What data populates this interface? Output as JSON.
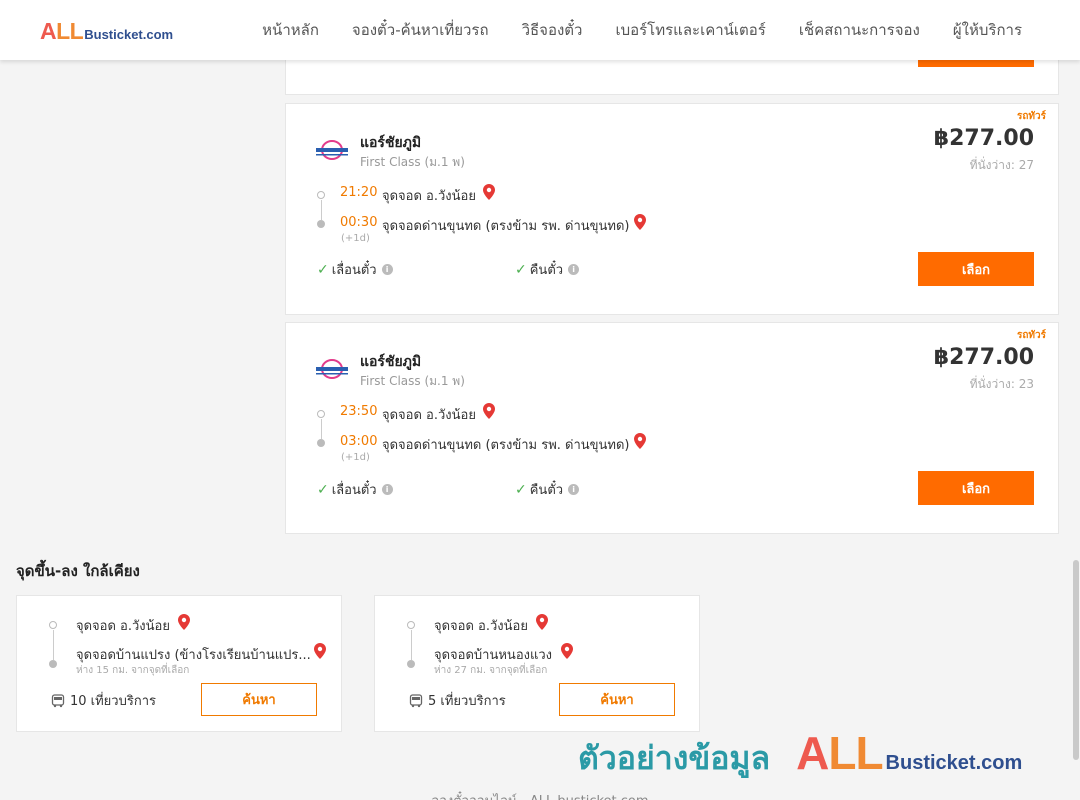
{
  "header": {
    "logo_all": "ALL",
    "logo_text": "Busticket.com",
    "nav": [
      "หน้าหลัก",
      "จองตั๋ว-ค้นหาเที่ยวรถ",
      "วิธีจองตั๋ว",
      "เบอร์โทรและเคาน์เตอร์",
      "เช็คสถานะการจอง",
      "ผู้ให้บริการ"
    ]
  },
  "trips": [
    {
      "tag": "รถทัวร์",
      "operator": "แอร์ชัยภูมิ",
      "class": "First Class (ม.1 พ)",
      "price": "฿277.00",
      "seats_label": "ที่นั่งว่าง: 27",
      "depart_time": "21:20",
      "depart_stop": "จุดจอด อ.วังน้อย",
      "arrive_time": "00:30",
      "arrive_stop": "จุดจอดด่านขุนทด (ตรงข้าม รพ. ด่านขุนทด)",
      "plus_day": "(+1d)",
      "feature_1": "เลื่อนตั๋ว",
      "feature_2": "คืนตั๋ว",
      "select_label": "เลือก"
    },
    {
      "tag": "รถทัวร์",
      "operator": "แอร์ชัยภูมิ",
      "class": "First Class (ม.1 พ)",
      "price": "฿277.00",
      "seats_label": "ที่นั่งว่าง: 23",
      "depart_time": "23:50",
      "depart_stop": "จุดจอด อ.วังน้อย",
      "arrive_time": "03:00",
      "arrive_stop": "จุดจอดด่านขุนทด (ตรงข้าม รพ. ด่านขุนทด)",
      "plus_day": "(+1d)",
      "feature_1": "เลื่อนตั๋ว",
      "feature_2": "คืนตั๋ว",
      "select_label": "เลือก"
    }
  ],
  "nearby": {
    "title": "จุดขึ้น-ลง ใกล้เคียง",
    "items": [
      {
        "from": "จุดจอด อ.วังน้อย",
        "to": "จุดจอดบ้านแปรง (ข้างโรงเรียนบ้านแปร...",
        "distance": "ห่าง 15 กม. จากจุดที่เลือก",
        "trips": "10 เที่ยวบริการ",
        "search_label": "ค้นหา"
      },
      {
        "from": "จุดจอด อ.วังน้อย",
        "to": "จุดจอดบ้านหนองแวง",
        "distance": "ห่าง 27 กม. จากจุดที่เลือก",
        "trips": "5 เที่ยวบริการ",
        "search_label": "ค้นหา"
      }
    ]
  },
  "watermark": {
    "thai": "ตัวอย่างข้อมูล",
    "all": "ALL",
    "site": "Busticket.com"
  },
  "footer": {
    "text": "จองตั๋วออนไลน์ - ALL busticket.com"
  },
  "colors": {
    "accent": "#ff6b00",
    "time": "#f07a00",
    "check": "#4caf50",
    "pin": "#e53935"
  }
}
